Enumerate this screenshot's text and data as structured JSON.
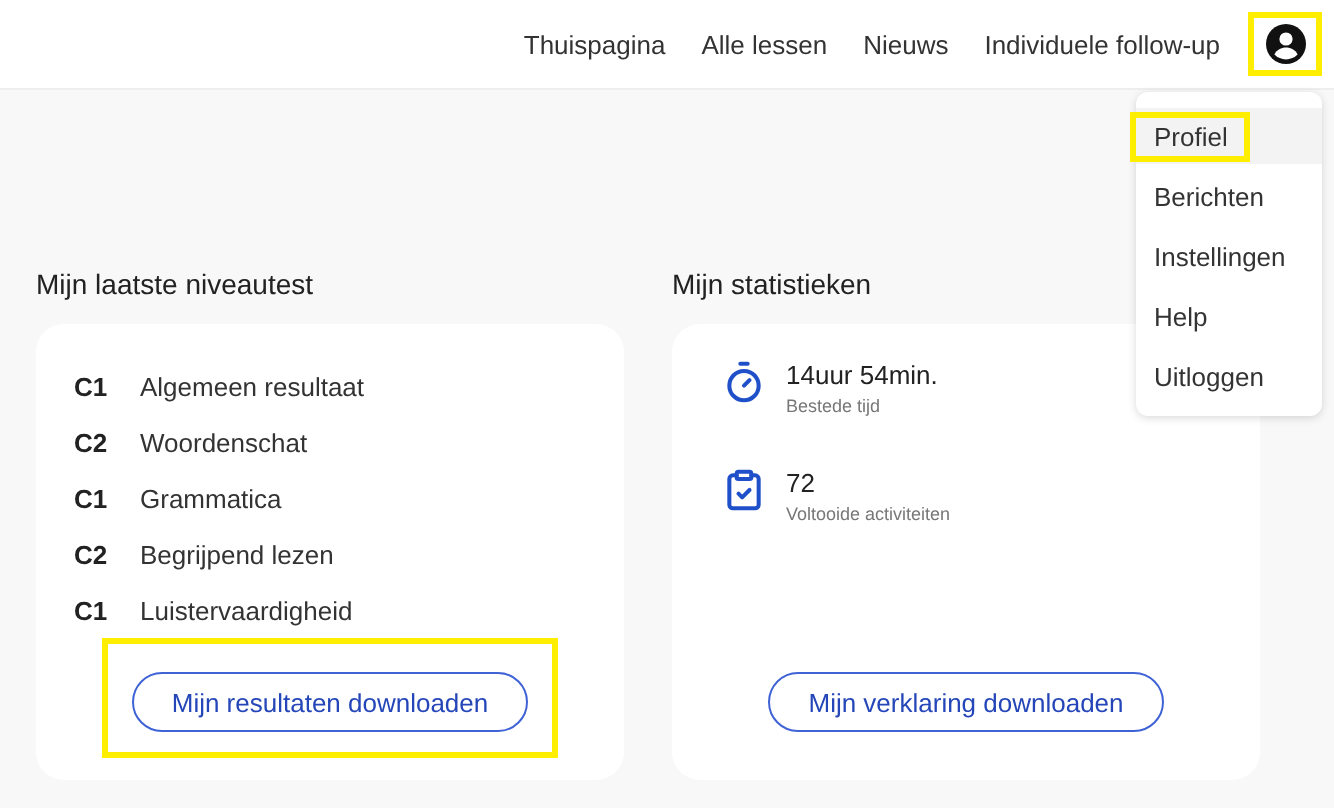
{
  "nav": {
    "links": [
      {
        "label": "Thuispagina"
      },
      {
        "label": "Alle lessen"
      },
      {
        "label": "Nieuws"
      },
      {
        "label": "Individuele follow-up"
      }
    ],
    "avatar": {
      "highlighted": true
    }
  },
  "menu": {
    "items": [
      {
        "label": "Profiel",
        "selected": true,
        "highlighted": true
      },
      {
        "label": "Berichten",
        "selected": false,
        "highlighted": false
      },
      {
        "label": "Instellingen",
        "selected": false,
        "highlighted": false
      },
      {
        "label": "Help",
        "selected": false,
        "highlighted": false
      },
      {
        "label": "Uitloggen",
        "selected": false,
        "highlighted": false
      }
    ]
  },
  "level_test": {
    "title": "Mijn laatste niveautest",
    "rows": [
      {
        "level": "C1",
        "label": "Algemeen resultaat"
      },
      {
        "level": "C2",
        "label": "Woordenschat"
      },
      {
        "level": "C1",
        "label": "Grammatica"
      },
      {
        "level": "C2",
        "label": "Begrijpend lezen"
      },
      {
        "level": "C1",
        "label": "Luistervaardigheid"
      }
    ],
    "button": {
      "label": "Mijn resultaten downloaden",
      "highlighted": true
    }
  },
  "statistics": {
    "title": "Mijn statistieken",
    "items": [
      {
        "kind": "time",
        "value": "14uur 54min.",
        "caption": "Bestede tijd"
      },
      {
        "kind": "activities",
        "value": "72",
        "caption": "Voltooide activiteiten"
      }
    ],
    "button": {
      "label": "Mijn verklaring downloaden",
      "highlighted": false
    }
  }
}
